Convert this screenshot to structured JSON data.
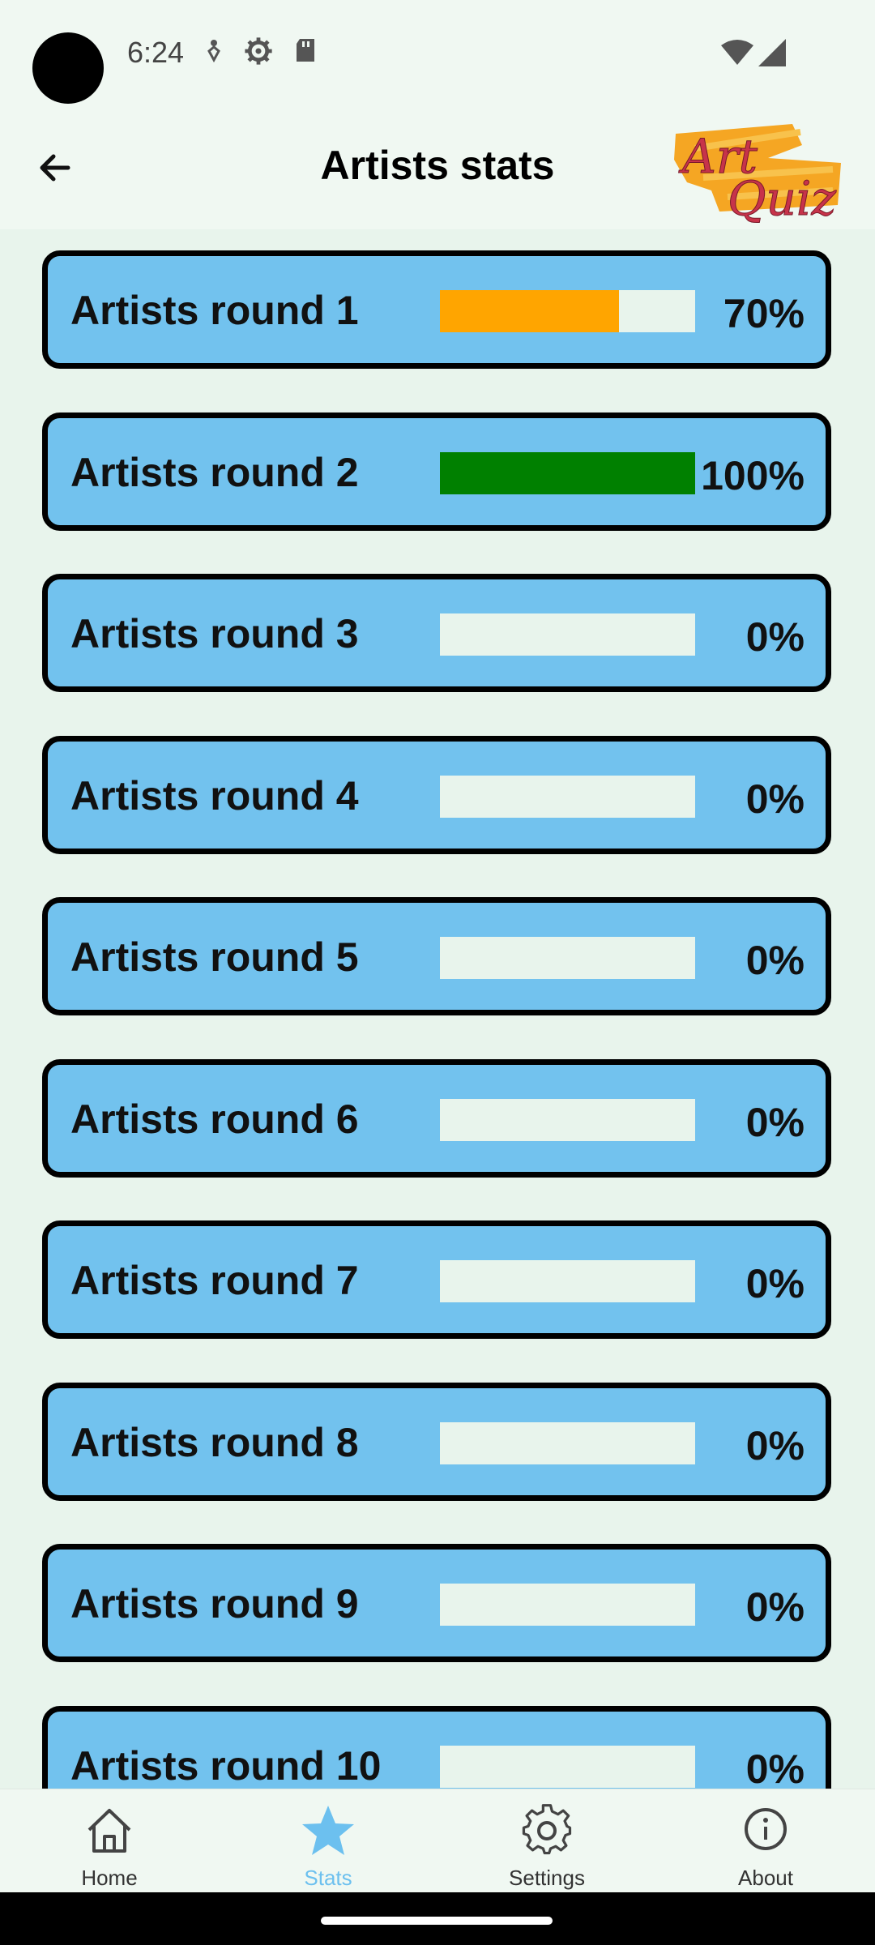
{
  "status_bar": {
    "time": "6:24",
    "icons": [
      "accessibility-icon",
      "settings-gear-icon",
      "sd-card-icon",
      "wifi-icon",
      "signal-icon"
    ]
  },
  "app_bar": {
    "title": "Artists stats",
    "logo_text": "Art Quiz",
    "back_icon": "arrow-back-icon"
  },
  "rounds": [
    {
      "label": "Artists round 1",
      "percent": "70%",
      "progress": 0.7,
      "fill_color": "#ffa500"
    },
    {
      "label": "Artists round 2",
      "percent": "100%",
      "progress": 1.0,
      "fill_color": "#008000"
    },
    {
      "label": "Artists round 3",
      "percent": "0%",
      "progress": 0,
      "fill_color": "#ffa500"
    },
    {
      "label": "Artists round 4",
      "percent": "0%",
      "progress": 0,
      "fill_color": "#ffa500"
    },
    {
      "label": "Artists round 5",
      "percent": "0%",
      "progress": 0,
      "fill_color": "#ffa500"
    },
    {
      "label": "Artists round 6",
      "percent": "0%",
      "progress": 0,
      "fill_color": "#ffa500"
    },
    {
      "label": "Artists round 7",
      "percent": "0%",
      "progress": 0,
      "fill_color": "#ffa500"
    },
    {
      "label": "Artists round 8",
      "percent": "0%",
      "progress": 0,
      "fill_color": "#ffa500"
    },
    {
      "label": "Artists round 9",
      "percent": "0%",
      "progress": 0,
      "fill_color": "#ffa500"
    },
    {
      "label": "Artists round 10",
      "percent": "0%",
      "progress": 0,
      "fill_color": "#ffa500"
    }
  ],
  "bottom_nav": {
    "items": [
      {
        "label": "Home",
        "icon": "home-icon",
        "active": false
      },
      {
        "label": "Stats",
        "icon": "star-icon",
        "active": true
      },
      {
        "label": "Settings",
        "icon": "gear-icon",
        "active": false
      },
      {
        "label": "About",
        "icon": "info-icon",
        "active": false
      }
    ]
  },
  "colors": {
    "card_background": "#72c2ee",
    "card_border": "#000000",
    "bar_track": "#e8f4ec",
    "active_nav": "#6cc0ef",
    "page_background": "#e8f4ec"
  }
}
